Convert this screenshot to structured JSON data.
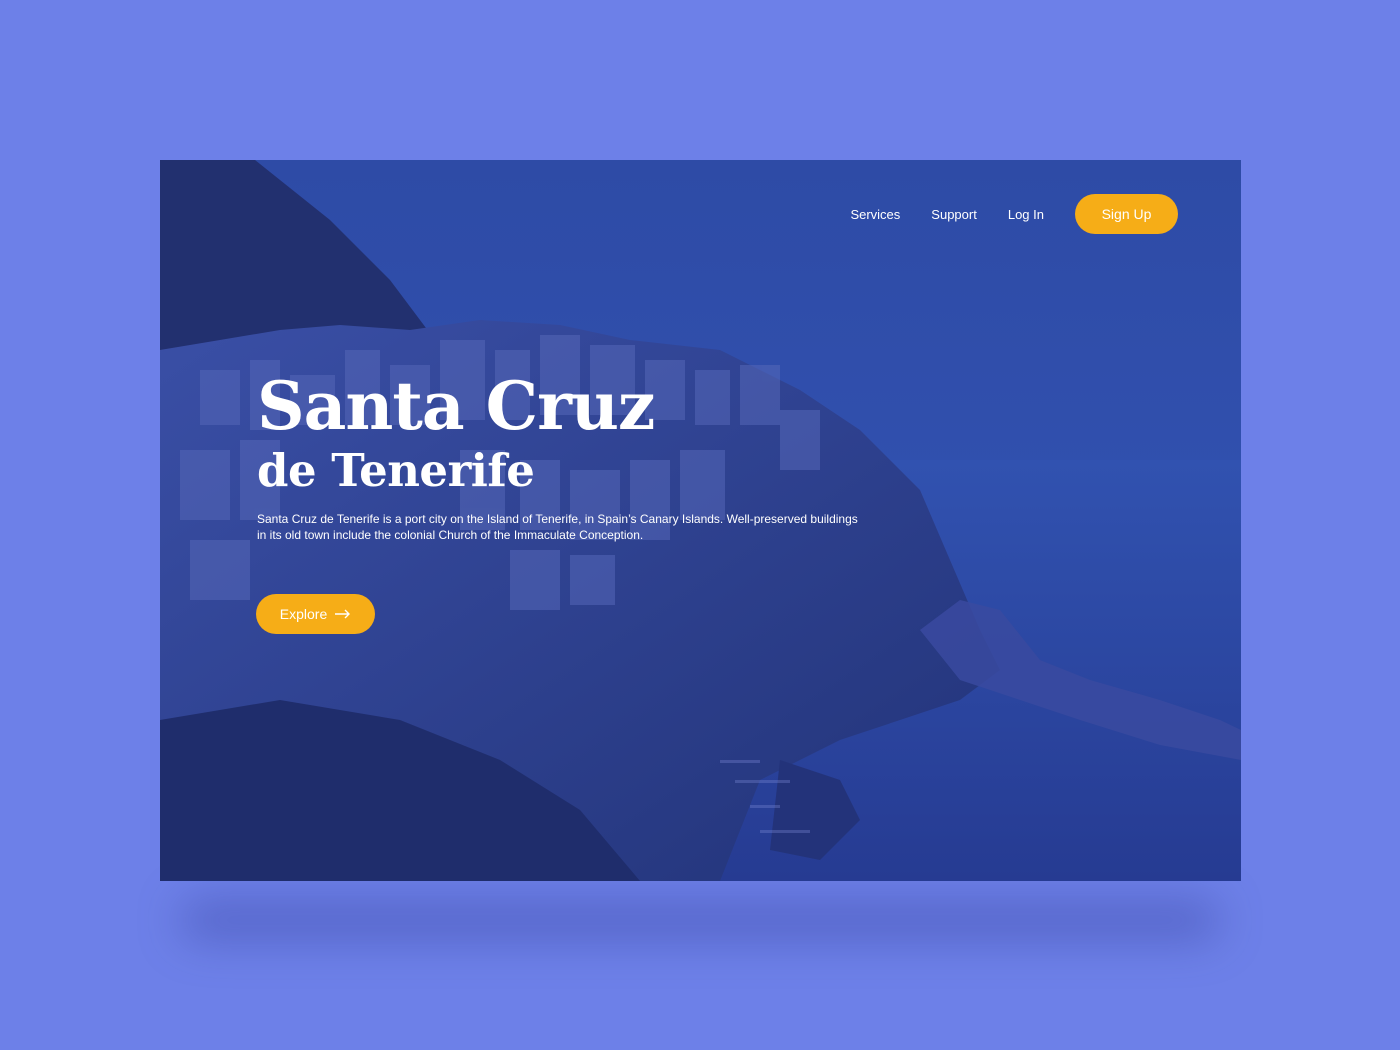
{
  "nav": {
    "links": [
      "Services",
      "Support",
      "Log In"
    ],
    "signup_label": "Sign Up"
  },
  "hero": {
    "title_line1": "Santa Cruz",
    "title_line2": "de Tenerife",
    "description": "Santa Cruz de Tenerife is a port city on the Island of Tenerife, in Spain’s Canary Islands. Well-preserved buildings in its old town include the colonial Church of the Immaculate Conception.",
    "cta_label": "Explore",
    "cta_icon": "arrow-right-icon"
  },
  "colors": {
    "page_background": "#6d80e8",
    "accent": "#f6ad17",
    "overlay": "#2a3f9c"
  }
}
